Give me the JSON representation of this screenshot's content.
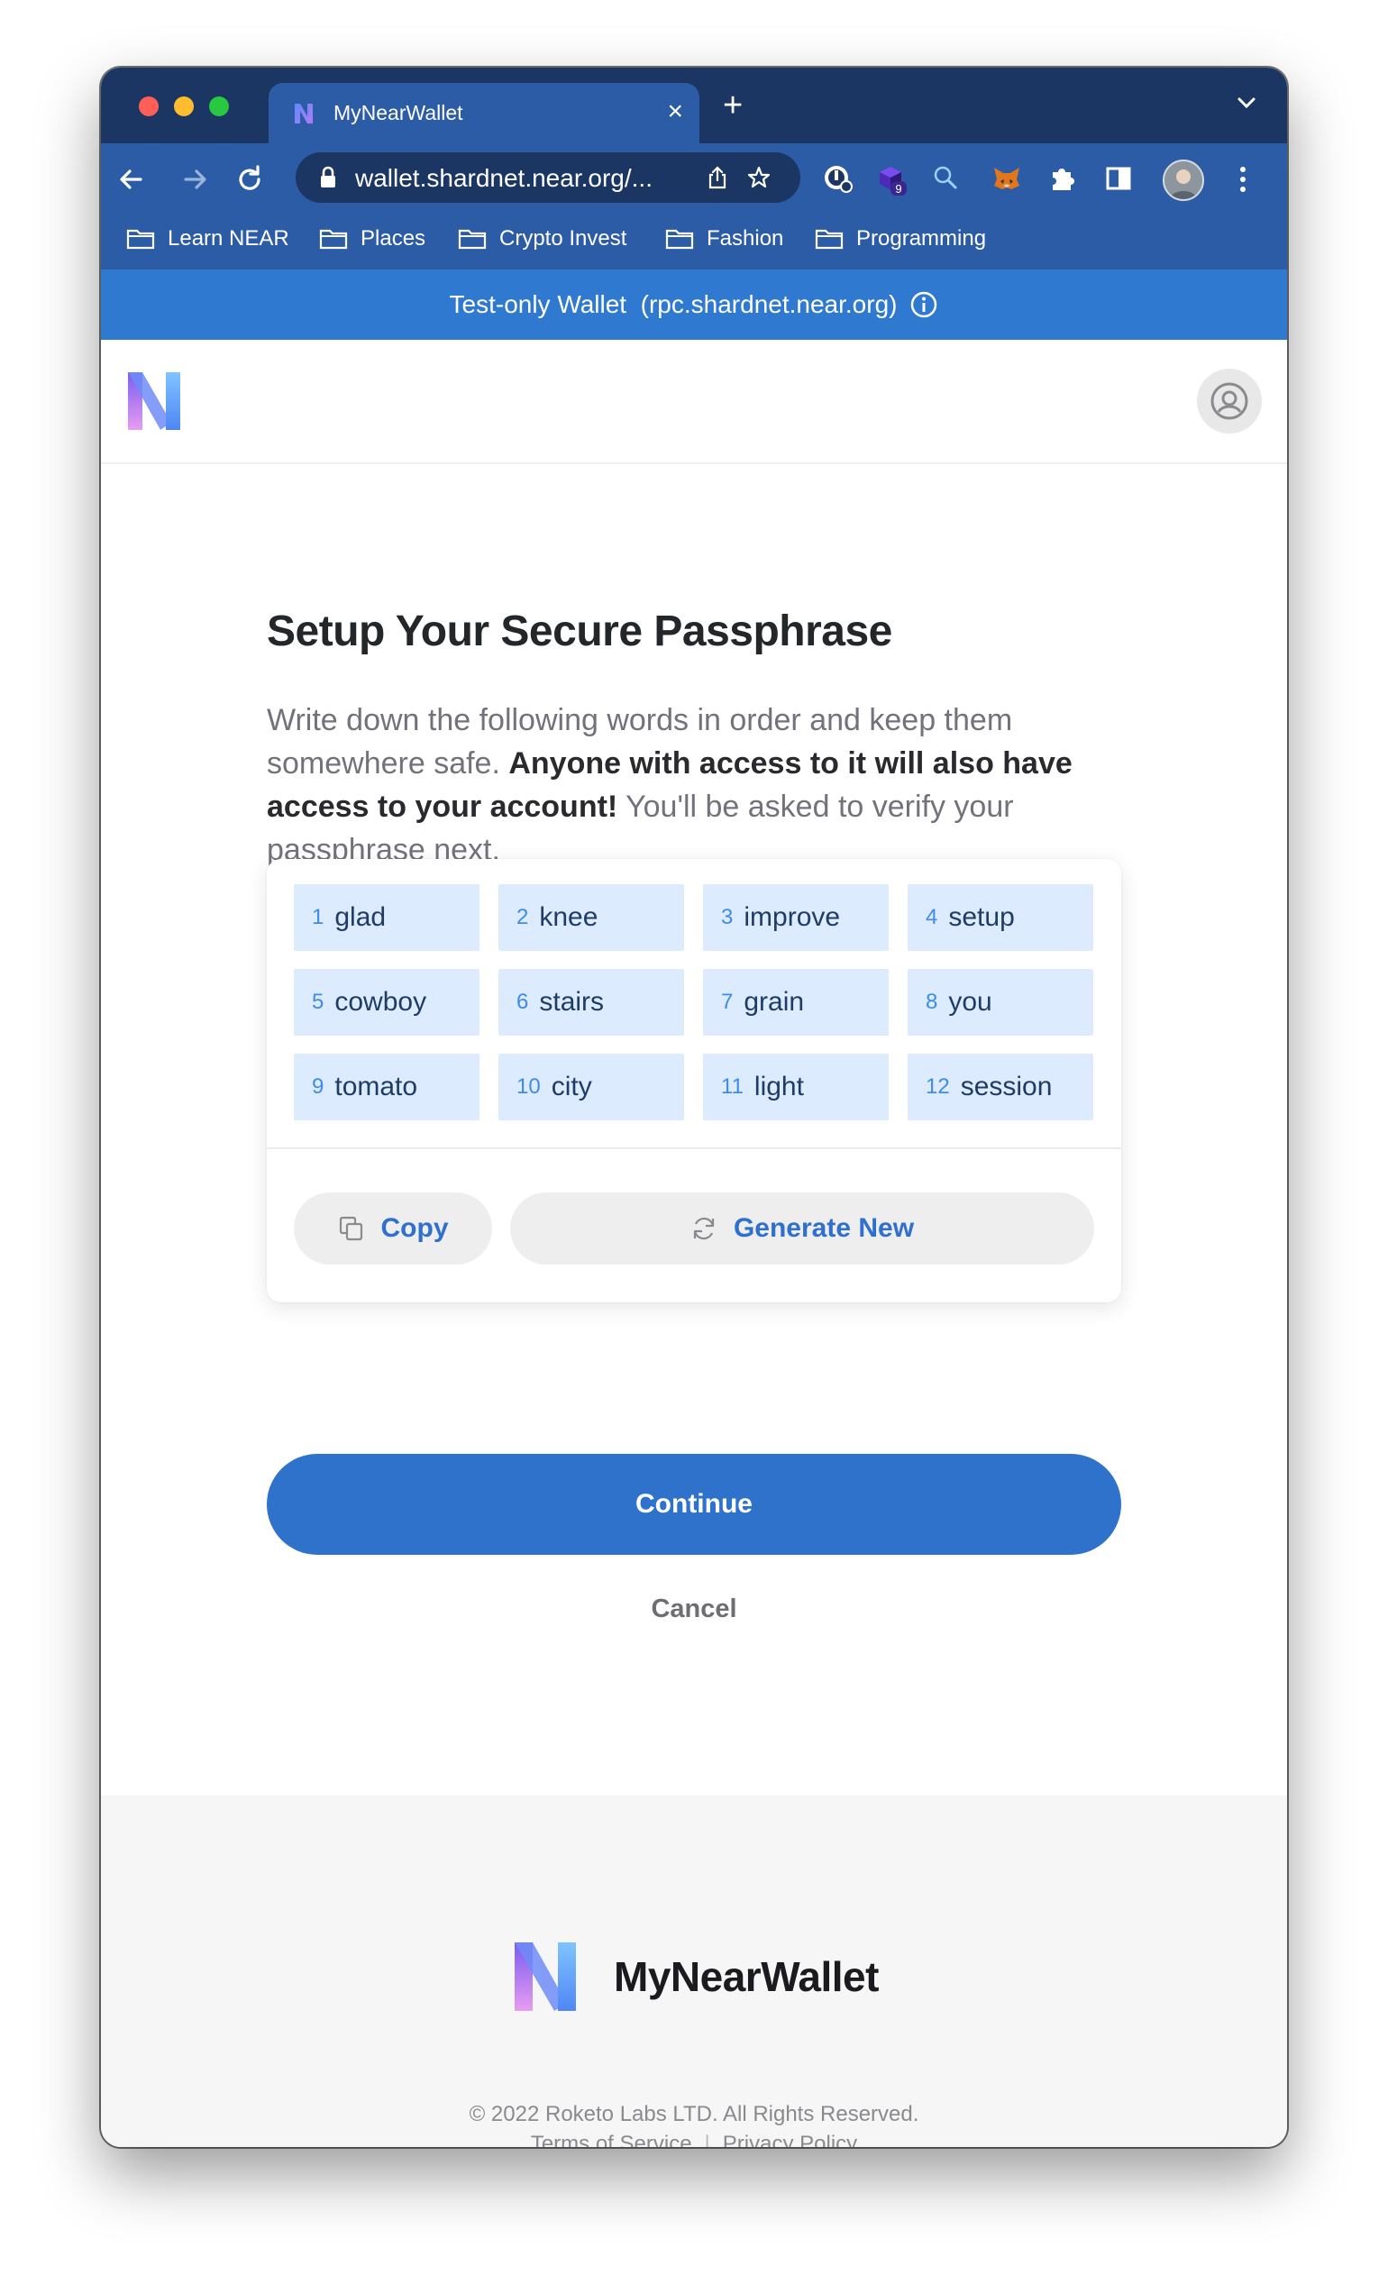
{
  "browser": {
    "tab_title": "MyNearWallet",
    "tab_close": "×",
    "new_tab": "+",
    "url": "wallet.shardnet.near.org/...",
    "extension_badge": "9",
    "bookmarks": [
      {
        "label": "Learn NEAR",
        "icon": "folder-icon"
      },
      {
        "label": "Places",
        "icon": "folder-icon"
      },
      {
        "label": "Crypto Invest",
        "icon": "folder-icon"
      },
      {
        "label": "Fashion",
        "icon": "folder-icon"
      },
      {
        "label": "Programming",
        "icon": "folder-icon"
      }
    ]
  },
  "banner": {
    "text": "Test-only Wallet  (rpc.shardnet.near.org)",
    "icon": "info-icon"
  },
  "page": {
    "title": "Setup Your Secure Passphrase",
    "description_part1": "Write down the following words in order and keep them somewhere safe. ",
    "description_bold": "Anyone with access to it will also have access to your account!",
    "description_part2": " You'll be asked to verify your passphrase next.",
    "words": [
      {
        "num": "1",
        "word": "glad"
      },
      {
        "num": "2",
        "word": "knee"
      },
      {
        "num": "3",
        "word": "improve"
      },
      {
        "num": "4",
        "word": "setup"
      },
      {
        "num": "5",
        "word": "cowboy"
      },
      {
        "num": "6",
        "word": "stairs"
      },
      {
        "num": "7",
        "word": "grain"
      },
      {
        "num": "8",
        "word": "you"
      },
      {
        "num": "9",
        "word": "tomato"
      },
      {
        "num": "10",
        "word": "city"
      },
      {
        "num": "11",
        "word": "light"
      },
      {
        "num": "12",
        "word": "session"
      }
    ],
    "copy_label": "Copy",
    "generate_label": "Generate New",
    "continue_label": "Continue",
    "cancel_label": "Cancel"
  },
  "footer": {
    "brand": "MyNearWallet",
    "copyright": "© 2022 Roketo Labs LTD. All Rights Reserved.",
    "terms": "Terms of Service",
    "separator": "|",
    "privacy": "Privacy Policy"
  },
  "colors": {
    "tabstrip": "#1c3663",
    "toolbar": "#2c5ca6",
    "banner": "#2f79d1",
    "word_bg": "#dcebfd",
    "accent": "#2f72cb"
  }
}
